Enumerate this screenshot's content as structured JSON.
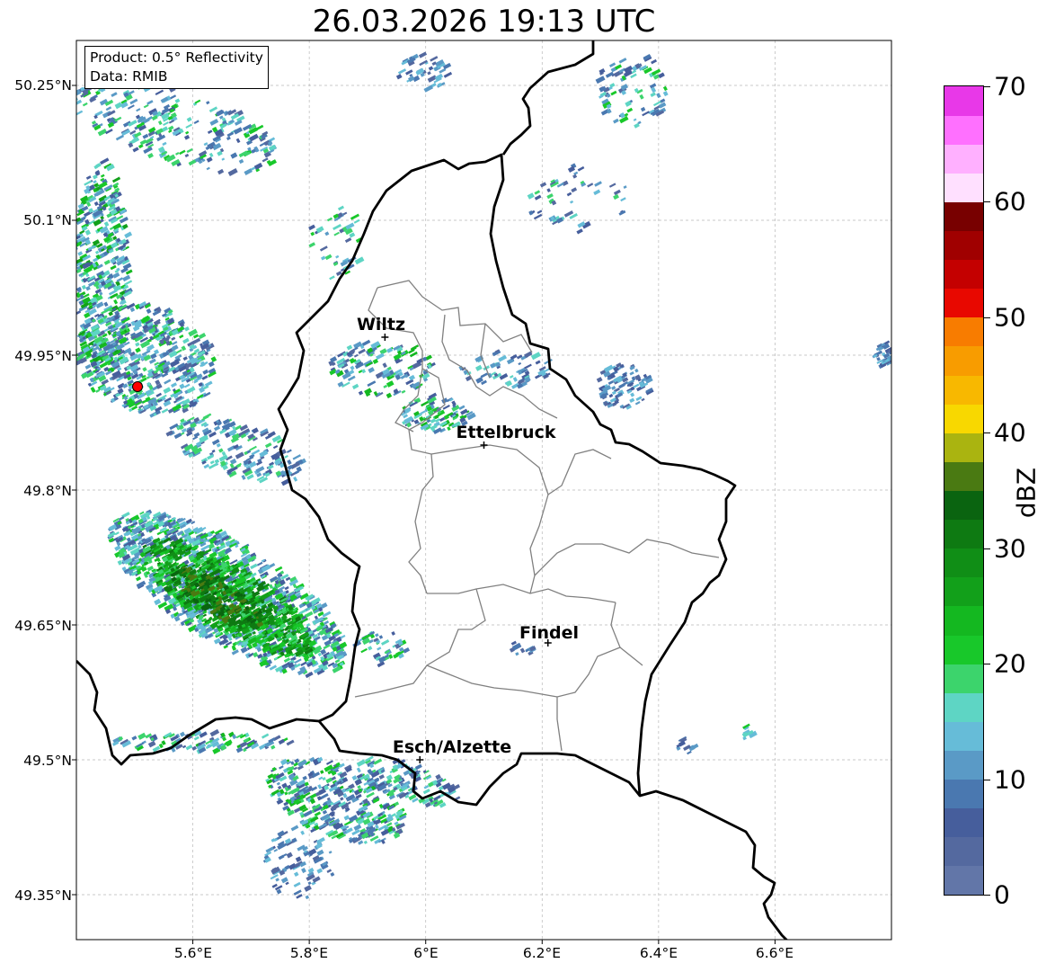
{
  "title": "26.03.2026 19:13 UTC",
  "info_box": {
    "product": "Product: 0.5° Reflectivity",
    "data": "Data: RMIB"
  },
  "lat_labels": [
    "50.25°N",
    "50.1°N",
    "49.95°N",
    "49.8°N",
    "49.65°N",
    "49.5°N",
    "49.35°N"
  ],
  "lon_labels": [
    "5.6°E",
    "5.8°E",
    "6°E",
    "6.2°E",
    "6.4°E",
    "6.6°E"
  ],
  "cities": [
    {
      "name": "Wiltz",
      "lon": 5.93,
      "lat": 49.97
    },
    {
      "name": "Ettelbruck",
      "lon": 6.1,
      "lat": 49.85
    },
    {
      "name": "Findel",
      "lon": 6.21,
      "lat": 49.63
    },
    {
      "name": "Esch/Alzette",
      "lon": 5.99,
      "lat": 49.5
    }
  ],
  "radar_site": {
    "lon": 5.505,
    "lat": 49.915
  },
  "colorbar": {
    "label": "dBZ",
    "min": 0,
    "max": 70,
    "ticks": [
      "0",
      "10",
      "20",
      "30",
      "40",
      "50",
      "60",
      "70"
    ],
    "colors": [
      "#6276a8",
      "#54699f",
      "#465e9c",
      "#4a78b0",
      "#5a9ac6",
      "#66bcd8",
      "#5ed5c4",
      "#3cd46c",
      "#18c82a",
      "#14b820",
      "#12a01a",
      "#108e16",
      "#0e7a12",
      "#0a6410",
      "#4a7a12",
      "#aab410",
      "#f8d800",
      "#f8b800",
      "#f89c00",
      "#f87c00",
      "#e80800",
      "#c40000",
      "#a00000",
      "#780000",
      "#ffe0ff",
      "#ffb0ff",
      "#ff70ff",
      "#e838e8"
    ]
  },
  "colors": {
    "border_country": "#000000",
    "border_canton": "#808080",
    "grid": "#b8b8b8",
    "radar_site": "#ff0000"
  }
}
